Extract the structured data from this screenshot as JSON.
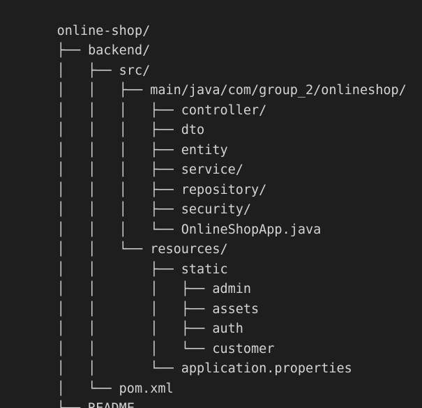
{
  "tree": {
    "root": "online-shop/",
    "lines": [
      {
        "prefix": "├── ",
        "name": "backend/"
      },
      {
        "prefix": "│   ├── ",
        "name": "src/"
      },
      {
        "prefix": "│   │   ├── ",
        "name": "main/java/com/group_2/onlineshop/"
      },
      {
        "prefix": "│   │   │   ├── ",
        "name": "controller/"
      },
      {
        "prefix": "│   │   │   ├── ",
        "name": "dto"
      },
      {
        "prefix": "│   │   │   ├── ",
        "name": "entity"
      },
      {
        "prefix": "│   │   │   ├── ",
        "name": "service/"
      },
      {
        "prefix": "│   │   │   ├── ",
        "name": "repository/"
      },
      {
        "prefix": "│   │   │   ├── ",
        "name": "security/"
      },
      {
        "prefix": "│   │   │   └── ",
        "name": "OnlineShopApp.java"
      },
      {
        "prefix": "│   │   └── ",
        "name": "resources/"
      },
      {
        "prefix": "│   │       ├── ",
        "name": "static"
      },
      {
        "prefix": "│   │       │   ├── ",
        "name": "admin"
      },
      {
        "prefix": "│   │       │   ├── ",
        "name": "assets"
      },
      {
        "prefix": "│   │       │   ├── ",
        "name": "auth"
      },
      {
        "prefix": "│   │       │   └── ",
        "name": "customer"
      },
      {
        "prefix": "│   │       └── ",
        "name": "application.properties"
      },
      {
        "prefix": "│   └── ",
        "name": "pom.xml"
      },
      {
        "prefix": "└── ",
        "name": "README."
      }
    ]
  }
}
